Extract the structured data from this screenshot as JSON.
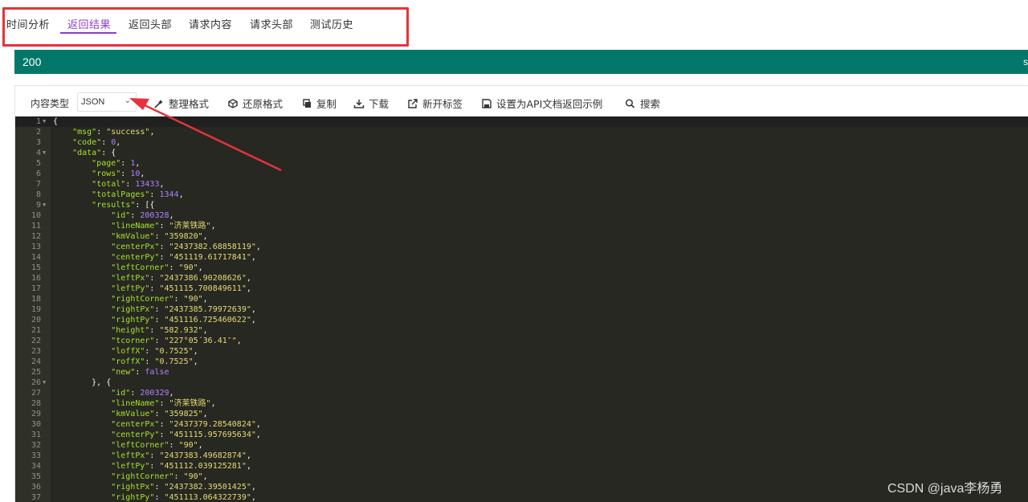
{
  "tabs": [
    {
      "label": "时间分析"
    },
    {
      "label": "返回结果"
    },
    {
      "label": "返回头部"
    },
    {
      "label": "请求内容"
    },
    {
      "label": "请求头部"
    },
    {
      "label": "测试历史"
    }
  ],
  "status": {
    "code": "200",
    "right_text": "s"
  },
  "toolbar": {
    "content_type_label": "内容类型",
    "content_type_value": "JSON",
    "format": "整理格式",
    "restore": "还原格式",
    "copy": "复制",
    "download": "下载",
    "new_tab": "新开标签",
    "set_example": "设置为API文档返回示例",
    "search": "搜索"
  },
  "editor": {
    "lines": [
      [
        [
          "p",
          "{"
        ]
      ],
      [
        [
          "p",
          "    "
        ],
        [
          "k",
          "\"msg\""
        ],
        [
          "p",
          ": "
        ],
        [
          "s",
          "\"success\""
        ],
        [
          "p",
          ","
        ]
      ],
      [
        [
          "p",
          "    "
        ],
        [
          "k",
          "\"code\""
        ],
        [
          "p",
          ": "
        ],
        [
          "n",
          "0"
        ],
        [
          "p",
          ","
        ]
      ],
      [
        [
          "p",
          "    "
        ],
        [
          "k",
          "\"data\""
        ],
        [
          "p",
          ": {"
        ]
      ],
      [
        [
          "p",
          "        "
        ],
        [
          "k",
          "\"page\""
        ],
        [
          "p",
          ": "
        ],
        [
          "n",
          "1"
        ],
        [
          "p",
          ","
        ]
      ],
      [
        [
          "p",
          "        "
        ],
        [
          "k",
          "\"rows\""
        ],
        [
          "p",
          ": "
        ],
        [
          "n",
          "10"
        ],
        [
          "p",
          ","
        ]
      ],
      [
        [
          "p",
          "        "
        ],
        [
          "k",
          "\"total\""
        ],
        [
          "p",
          ": "
        ],
        [
          "n",
          "13433"
        ],
        [
          "p",
          ","
        ]
      ],
      [
        [
          "p",
          "        "
        ],
        [
          "k",
          "\"totalPages\""
        ],
        [
          "p",
          ": "
        ],
        [
          "n",
          "1344"
        ],
        [
          "p",
          ","
        ]
      ],
      [
        [
          "p",
          "        "
        ],
        [
          "k",
          "\"results\""
        ],
        [
          "p",
          ": [{"
        ]
      ],
      [
        [
          "p",
          "            "
        ],
        [
          "k",
          "\"id\""
        ],
        [
          "p",
          ": "
        ],
        [
          "n",
          "200328"
        ],
        [
          "p",
          ","
        ]
      ],
      [
        [
          "p",
          "            "
        ],
        [
          "k",
          "\"lineName\""
        ],
        [
          "p",
          ": "
        ],
        [
          "s",
          "\"济莱铁路\""
        ],
        [
          "p",
          ","
        ]
      ],
      [
        [
          "p",
          "            "
        ],
        [
          "k",
          "\"kmValue\""
        ],
        [
          "p",
          ": "
        ],
        [
          "s",
          "\"359820\""
        ],
        [
          "p",
          ","
        ]
      ],
      [
        [
          "p",
          "            "
        ],
        [
          "k",
          "\"centerPx\""
        ],
        [
          "p",
          ": "
        ],
        [
          "s",
          "\"2437382.68858119\""
        ],
        [
          "p",
          ","
        ]
      ],
      [
        [
          "p",
          "            "
        ],
        [
          "k",
          "\"centerPy\""
        ],
        [
          "p",
          ": "
        ],
        [
          "s",
          "\"451119.61717841\""
        ],
        [
          "p",
          ","
        ]
      ],
      [
        [
          "p",
          "            "
        ],
        [
          "k",
          "\"leftCorner\""
        ],
        [
          "p",
          ": "
        ],
        [
          "s",
          "\"90\""
        ],
        [
          "p",
          ","
        ]
      ],
      [
        [
          "p",
          "            "
        ],
        [
          "k",
          "\"leftPx\""
        ],
        [
          "p",
          ": "
        ],
        [
          "s",
          "\"2437386.90208626\""
        ],
        [
          "p",
          ","
        ]
      ],
      [
        [
          "p",
          "            "
        ],
        [
          "k",
          "\"leftPy\""
        ],
        [
          "p",
          ": "
        ],
        [
          "s",
          "\"451115.700849611\""
        ],
        [
          "p",
          ","
        ]
      ],
      [
        [
          "p",
          "            "
        ],
        [
          "k",
          "\"rightCorner\""
        ],
        [
          "p",
          ": "
        ],
        [
          "s",
          "\"90\""
        ],
        [
          "p",
          ","
        ]
      ],
      [
        [
          "p",
          "            "
        ],
        [
          "k",
          "\"rightPx\""
        ],
        [
          "p",
          ": "
        ],
        [
          "s",
          "\"2437385.79972639\""
        ],
        [
          "p",
          ","
        ]
      ],
      [
        [
          "p",
          "            "
        ],
        [
          "k",
          "\"rightPy\""
        ],
        [
          "p",
          ": "
        ],
        [
          "s",
          "\"451116.725460622\""
        ],
        [
          "p",
          ","
        ]
      ],
      [
        [
          "p",
          "            "
        ],
        [
          "k",
          "\"height\""
        ],
        [
          "p",
          ": "
        ],
        [
          "s",
          "\"582.932\""
        ],
        [
          "p",
          ","
        ]
      ],
      [
        [
          "p",
          "            "
        ],
        [
          "k",
          "\"tcorner\""
        ],
        [
          "p",
          ": "
        ],
        [
          "s",
          "\"227°05´36.41″\""
        ],
        [
          "p",
          ","
        ]
      ],
      [
        [
          "p",
          "            "
        ],
        [
          "k",
          "\"loffX\""
        ],
        [
          "p",
          ": "
        ],
        [
          "s",
          "\"0.7525\""
        ],
        [
          "p",
          ","
        ]
      ],
      [
        [
          "p",
          "            "
        ],
        [
          "k",
          "\"roffX\""
        ],
        [
          "p",
          ": "
        ],
        [
          "s",
          "\"0.7525\""
        ],
        [
          "p",
          ","
        ]
      ],
      [
        [
          "p",
          "            "
        ],
        [
          "k",
          "\"new\""
        ],
        [
          "p",
          ": "
        ],
        [
          "b",
          "false"
        ]
      ],
      [
        [
          "p",
          "        }, {"
        ]
      ],
      [
        [
          "p",
          "            "
        ],
        [
          "k",
          "\"id\""
        ],
        [
          "p",
          ": "
        ],
        [
          "n",
          "200329"
        ],
        [
          "p",
          ","
        ]
      ],
      [
        [
          "p",
          "            "
        ],
        [
          "k",
          "\"lineName\""
        ],
        [
          "p",
          ": "
        ],
        [
          "s",
          "\"济莱铁路\""
        ],
        [
          "p",
          ","
        ]
      ],
      [
        [
          "p",
          "            "
        ],
        [
          "k",
          "\"kmValue\""
        ],
        [
          "p",
          ": "
        ],
        [
          "s",
          "\"359825\""
        ],
        [
          "p",
          ","
        ]
      ],
      [
        [
          "p",
          "            "
        ],
        [
          "k",
          "\"centerPx\""
        ],
        [
          "p",
          ": "
        ],
        [
          "s",
          "\"2437379.28540824\""
        ],
        [
          "p",
          ","
        ]
      ],
      [
        [
          "p",
          "            "
        ],
        [
          "k",
          "\"centerPy\""
        ],
        [
          "p",
          ": "
        ],
        [
          "s",
          "\"451115.957695634\""
        ],
        [
          "p",
          ","
        ]
      ],
      [
        [
          "p",
          "            "
        ],
        [
          "k",
          "\"leftCorner\""
        ],
        [
          "p",
          ": "
        ],
        [
          "s",
          "\"90\""
        ],
        [
          "p",
          ","
        ]
      ],
      [
        [
          "p",
          "            "
        ],
        [
          "k",
          "\"leftPx\""
        ],
        [
          "p",
          ": "
        ],
        [
          "s",
          "\"2437383.49682874\""
        ],
        [
          "p",
          ","
        ]
      ],
      [
        [
          "p",
          "            "
        ],
        [
          "k",
          "\"leftPy\""
        ],
        [
          "p",
          ": "
        ],
        [
          "s",
          "\"451112.039125281\""
        ],
        [
          "p",
          ","
        ]
      ],
      [
        [
          "p",
          "            "
        ],
        [
          "k",
          "\"rightCorner\""
        ],
        [
          "p",
          ": "
        ],
        [
          "s",
          "\"90\""
        ],
        [
          "p",
          ","
        ]
      ],
      [
        [
          "p",
          "            "
        ],
        [
          "k",
          "\"rightPx\""
        ],
        [
          "p",
          ": "
        ],
        [
          "s",
          "\"2437382.39501425\""
        ],
        [
          "p",
          ","
        ]
      ],
      [
        [
          "p",
          "            "
        ],
        [
          "k",
          "\"rightPy\""
        ],
        [
          "p",
          ": "
        ],
        [
          "s",
          "\"451113.064322739\""
        ],
        [
          "p",
          ","
        ]
      ]
    ],
    "fold_lines": [
      1,
      4,
      9,
      26
    ]
  },
  "watermark": "CSDN @java李杨勇",
  "colors": {
    "accent": "#8b3fc6",
    "status_bg": "#02776a",
    "highlight": "#e5333b",
    "editor_bg": "#272822"
  }
}
